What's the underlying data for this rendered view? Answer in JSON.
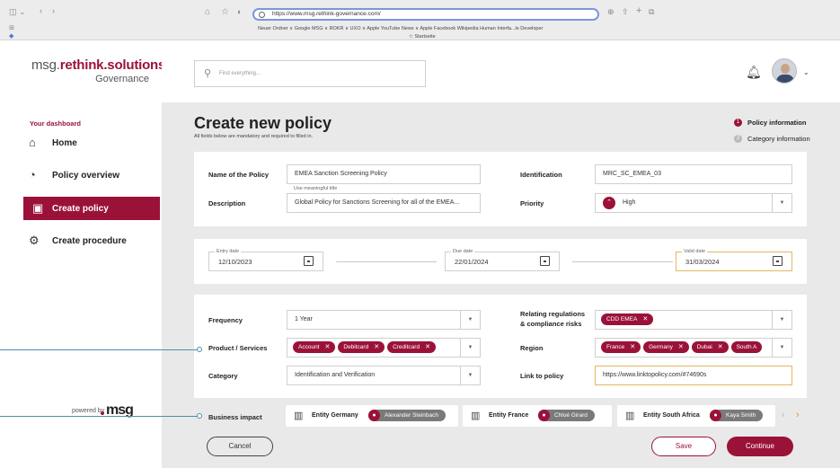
{
  "browser": {
    "url": "https://www.msg.rethink-governance.com/",
    "bookmarks": "Neuer Ordner ∨   Google   MSG ∨   ROKR ∨   UXO ∨   Apple   YouTube   News ∨   Apple   Facebook   Wikipedia   Human Interfa...le Developer",
    "start_page": "☆ Startseite"
  },
  "brand": {
    "prefix": "msg.",
    "name": "rethink.solutions",
    "sub": "Governance"
  },
  "sidebar": {
    "section_title": "Your dashboard",
    "items": [
      {
        "label": "Home",
        "icon": "⌂"
      },
      {
        "label": "Policy overview",
        "icon": "◔"
      },
      {
        "label": "Create policy",
        "icon": "▣"
      },
      {
        "label": "Create procedure",
        "icon": "⚙"
      }
    ],
    "powered_by": "powered by",
    "footer_logo": "msg"
  },
  "topbar": {
    "search_placeholder": "Find everything..."
  },
  "page": {
    "title": "Create new policy",
    "subtitle": "All fields below are mandatory and required to filled in."
  },
  "steps": [
    {
      "num": "1",
      "label": "Policy information"
    },
    {
      "num": "2",
      "label": "Category information"
    }
  ],
  "form": {
    "name_label": "Name of the Policy",
    "name_value": "EMEA Sanction Screening Policy",
    "name_helper": "Use meaningful title",
    "identification_label": "Identification",
    "identification_value": "MRC_SC_EMEA_03",
    "description_label": "Description",
    "description_value": "Global Policy for Sanctions Screening for all of the EMEA...",
    "priority_label": "Priority",
    "priority_value": "High",
    "entry_label": "Entry date",
    "entry_value": "12/10/2023",
    "due_label": "Due date",
    "due_value": "22/01/2024",
    "valid_label": "Valid date",
    "valid_value": "31/03/2024",
    "frequency_label": "Frequency",
    "frequency_value": "1 Year",
    "regulations_label_1": "Relating regulations",
    "regulations_label_2": "& compliance risks",
    "regulations_chips": [
      "CDD EMEA"
    ],
    "product_label": "Product / Services",
    "product_chips": [
      "Account",
      "Debitcard",
      "Creditcard"
    ],
    "region_label": "Region",
    "region_chips": [
      "France",
      "Germany",
      "Dubai",
      "South A"
    ],
    "category_label": "Category",
    "category_value": "Identification and Verification",
    "link_label": "Link to policy",
    "link_value": "https://www.linktopolicy.com/#74690s"
  },
  "impact": {
    "label": "Business impact",
    "entities": [
      {
        "name": "Entity Germany",
        "person": "Alexander Steinbach"
      },
      {
        "name": "Entity France",
        "person": "Chloé Girard"
      },
      {
        "name": "Entity South Africa",
        "person": "Kaya Smith"
      }
    ]
  },
  "actions": {
    "cancel": "Cancel",
    "save": "Save",
    "continue": "Continue"
  },
  "colors": {
    "accent": "#9b1239",
    "annotation": "#4a8fa8"
  }
}
